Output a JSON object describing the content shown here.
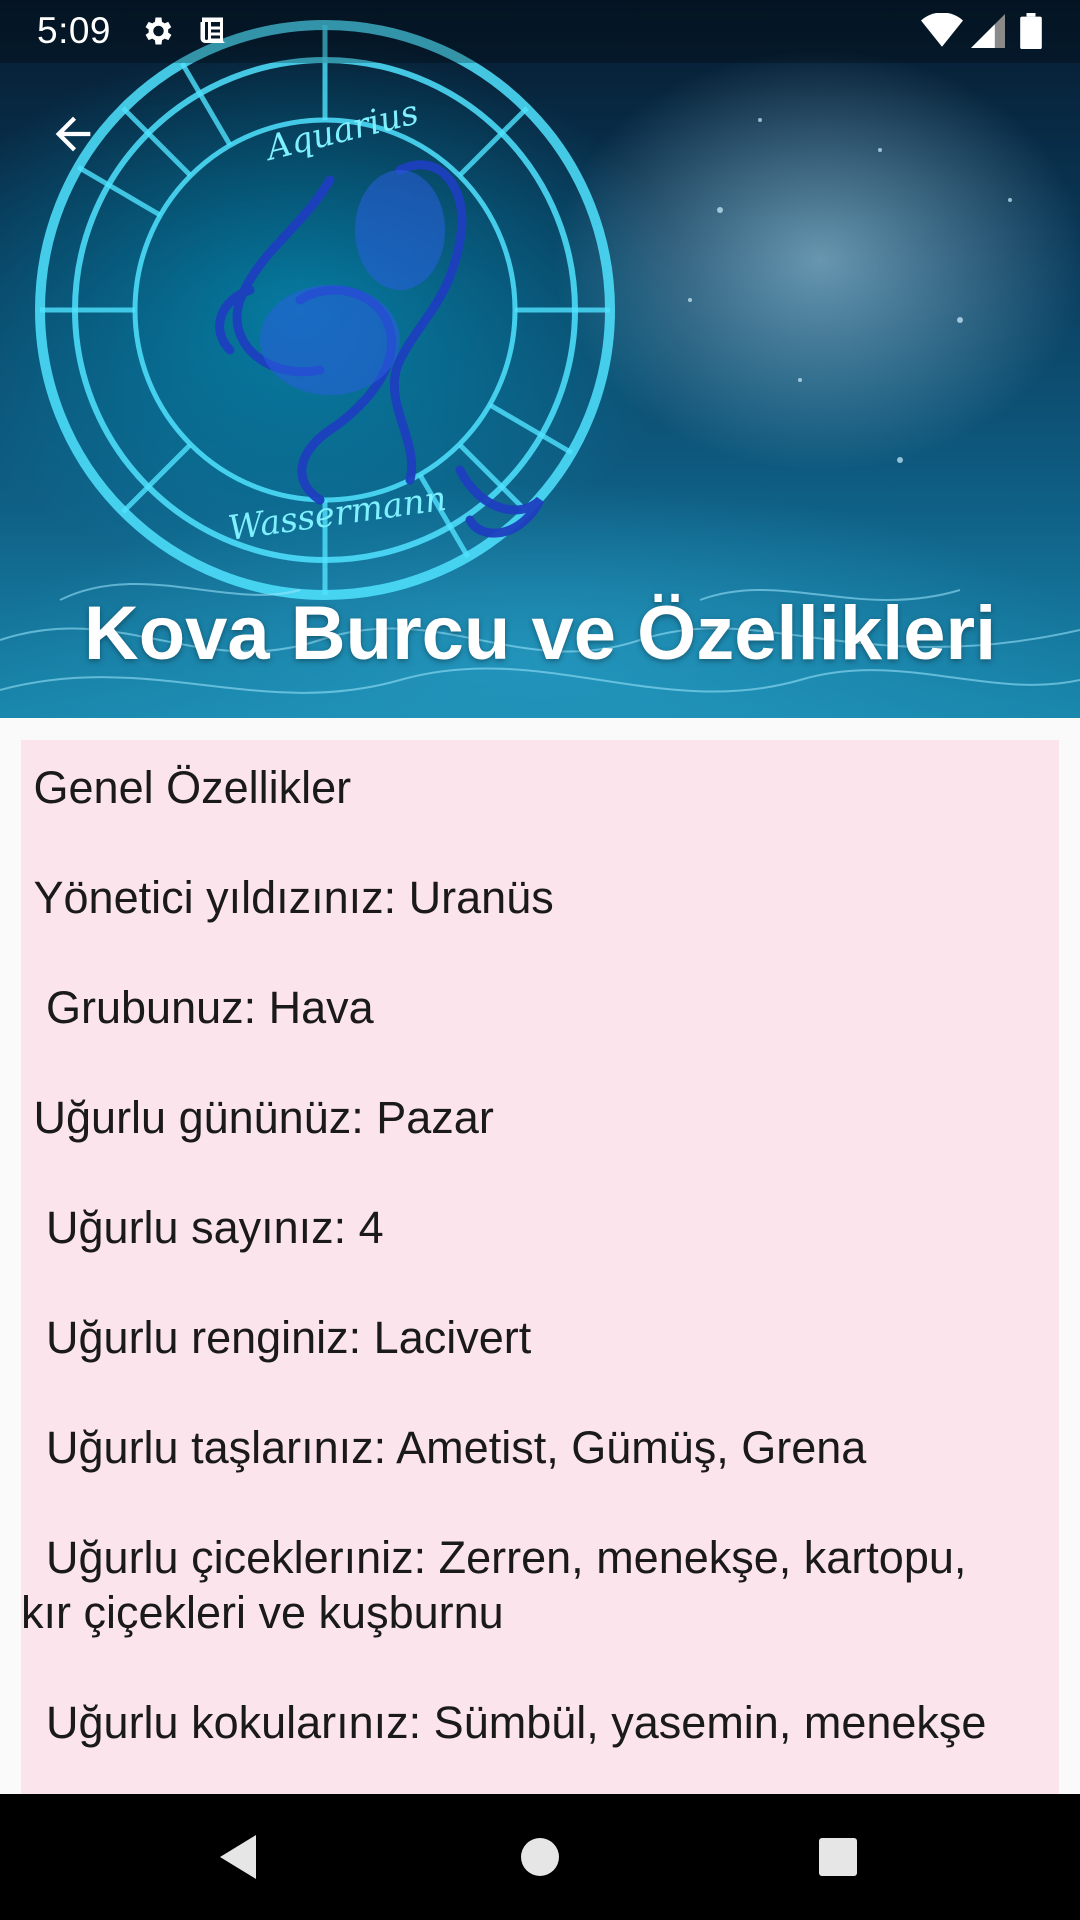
{
  "status_bar": {
    "time": "5:09",
    "left_icons": [
      "gear-icon",
      "news-icon"
    ],
    "right_icons": [
      "wifi-icon",
      "signal-icon",
      "battery-icon"
    ]
  },
  "header": {
    "image": "aquarius-zodiac-illustration",
    "title": "Kova Burcu ve Özellikleri"
  },
  "content": {
    "background_color": "#fce4ec",
    "lines": [
      " Genel Özellikler",
      " Yönetici yıldızınız: Uranüs",
      "  Grubunuz: Hava",
      " Uğurlu gününüz: Pazar",
      "  Uğurlu sayınız: 4",
      "  Uğurlu renginiz: Lacivert",
      "  Uğurlu taşlarınız: Ametist, Gümüş, Grena",
      "  Uğurlu çiceklerıniz: Zerren, menekşe, kartopu,\nkır çiçekleri ve kuşburnu",
      "  Uğurlu kokularınız: Sümbül, yasemin, menekşe"
    ]
  },
  "navigation": {
    "buttons": [
      "back-triangle-icon",
      "home-circle-icon",
      "recents-square-icon"
    ]
  }
}
